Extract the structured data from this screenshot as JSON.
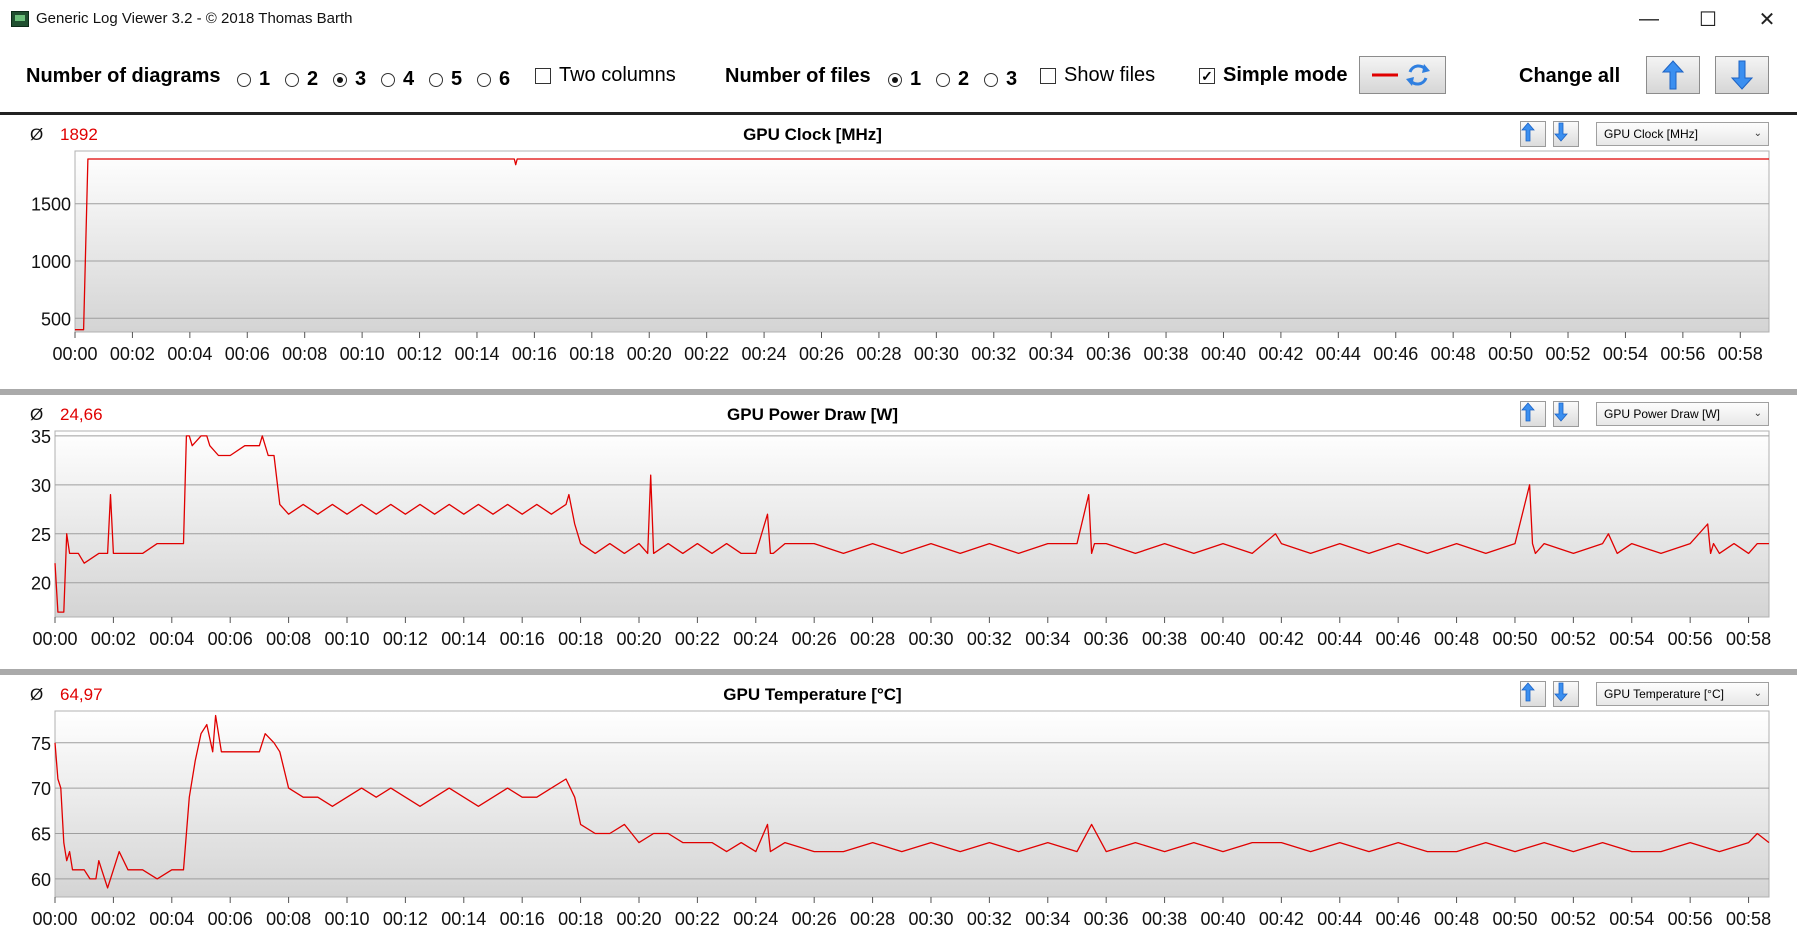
{
  "window": {
    "title": "Generic Log Viewer 3.2 - © 2018 Thomas Barth",
    "minimize": "—",
    "maximize": "☐",
    "close": "✕"
  },
  "toolbar": {
    "diagrams_label": "Number of diagrams",
    "diagram_options": [
      "1",
      "2",
      "3",
      "4",
      "5",
      "6"
    ],
    "diagram_selected": "3",
    "two_columns_label": "Two columns",
    "two_columns_checked": false,
    "files_label": "Number of files",
    "file_options": [
      "1",
      "2",
      "3"
    ],
    "file_selected": "1",
    "show_files_label": "Show files",
    "show_files_checked": false,
    "simple_mode_label": "Simple mode",
    "simple_mode_checked": true,
    "change_all_label": "Change all"
  },
  "colors": {
    "series": "#e00000",
    "grid": "#9e9e9e",
    "accent": "#2f7fe0"
  },
  "panels": [
    {
      "average_symbol": "Ø",
      "average_value": "1892",
      "title": "GPU Clock [MHz]",
      "selector": "GPU Clock [MHz]"
    },
    {
      "average_symbol": "Ø",
      "average_value": "24,66",
      "title": "GPU Power Draw [W]",
      "selector": "GPU Power Draw [W]"
    },
    {
      "average_symbol": "Ø",
      "average_value": "64,97",
      "title": "GPU Temperature [°C]",
      "selector": "GPU Temperature [°C]"
    }
  ],
  "chart_data": [
    {
      "type": "line",
      "title": "GPU Clock [MHz]",
      "x_ticks": [
        "00:00",
        "00:02",
        "00:04",
        "00:06",
        "00:08",
        "00:10",
        "00:12",
        "00:14",
        "00:16",
        "00:18",
        "00:20",
        "00:22",
        "00:24",
        "00:26",
        "00:28",
        "00:30",
        "00:32",
        "00:34",
        "00:36",
        "00:38",
        "00:40",
        "00:42",
        "00:44",
        "00:46",
        "00:48",
        "00:50",
        "00:52",
        "00:54",
        "00:56",
        "00:58"
      ],
      "y_ticks": [
        500,
        1000,
        1500
      ],
      "xlim": [
        0,
        59
      ],
      "ylim": [
        380,
        1960
      ],
      "series": [
        {
          "x": [
            0,
            0.3,
            0.45,
            15.3,
            15.35,
            15.4,
            59
          ],
          "y": [
            400,
            400,
            1890,
            1890,
            1840,
            1890,
            1890
          ]
        }
      ]
    },
    {
      "type": "line",
      "title": "GPU Power Draw [W]",
      "x_ticks": [
        "00:00",
        "00:02",
        "00:04",
        "00:06",
        "00:08",
        "00:10",
        "00:12",
        "00:14",
        "00:16",
        "00:18",
        "00:20",
        "00:22",
        "00:24",
        "00:26",
        "00:28",
        "00:30",
        "00:32",
        "00:34",
        "00:36",
        "00:38",
        "00:40",
        "00:42",
        "00:44",
        "00:46",
        "00:48",
        "00:50",
        "00:52",
        "00:54",
        "00:56",
        "00:58"
      ],
      "y_ticks": [
        20,
        25,
        30,
        35
      ],
      "xlim": [
        0,
        58.7
      ],
      "ylim": [
        16.5,
        35.5
      ],
      "series": [
        {
          "x": [
            0,
            0.1,
            0.2,
            0.3,
            0.4,
            0.5,
            0.6,
            0.8,
            1.0,
            1.5,
            1.8,
            1.9,
            2.0,
            2.2,
            3.0,
            3.5,
            4.4,
            4.5,
            4.6,
            4.7,
            5.0,
            5.2,
            5.3,
            5.6,
            6.0,
            6.5,
            7.0,
            7.1,
            7.3,
            7.5,
            7.7,
            8.0,
            8.5,
            9.0,
            9.5,
            10.0,
            10.5,
            11.0,
            11.5,
            12.0,
            12.5,
            13.0,
            13.5,
            14.0,
            14.5,
            15.0,
            15.5,
            16.0,
            16.5,
            17.0,
            17.5,
            17.6,
            17.8,
            18.0,
            18.5,
            19.0,
            19.5,
            20.0,
            20.3,
            20.4,
            20.5,
            21.0,
            21.5,
            22.0,
            22.5,
            23.0,
            23.5,
            24.0,
            24.4,
            24.5,
            24.6,
            25.0,
            26.0,
            27.0,
            28.0,
            29.0,
            30.0,
            31.0,
            32.0,
            33.0,
            34.0,
            35.0,
            35.4,
            35.5,
            35.6,
            36.0,
            37.0,
            38.0,
            39.0,
            40.0,
            41.0,
            41.8,
            42.0,
            43.0,
            44.0,
            45.0,
            46.0,
            47.0,
            48.0,
            49.0,
            50.0,
            50.5,
            50.6,
            50.7,
            51.0,
            52.0,
            53.0,
            53.2,
            53.5,
            54.0,
            55.0,
            56.0,
            56.6,
            56.7,
            56.8,
            57.0,
            57.5,
            58.0,
            58.3,
            58.7
          ],
          "y": [
            22,
            17,
            17,
            17,
            25,
            23,
            23,
            23,
            22,
            23,
            23,
            29,
            23,
            23,
            23,
            24,
            24,
            35,
            35,
            34,
            35,
            35,
            34,
            33,
            33,
            34,
            34,
            35,
            33,
            33,
            28,
            27,
            28,
            27,
            28,
            27,
            28,
            27,
            28,
            27,
            28,
            27,
            28,
            27,
            28,
            27,
            28,
            27,
            28,
            27,
            28,
            29,
            26,
            24,
            23,
            24,
            23,
            24,
            23,
            31,
            23,
            24,
            23,
            24,
            23,
            24,
            23,
            23,
            27,
            23,
            23,
            24,
            24,
            23,
            24,
            23,
            24,
            23,
            24,
            23,
            24,
            24,
            29,
            23,
            24,
            24,
            23,
            24,
            23,
            24,
            23,
            25,
            24,
            23,
            24,
            23,
            24,
            23,
            24,
            23,
            24,
            30,
            24,
            23,
            24,
            23,
            24,
            25,
            23,
            24,
            23,
            24,
            26,
            23,
            24,
            23,
            24,
            23,
            24,
            24
          ]
        }
      ]
    },
    {
      "type": "line",
      "title": "GPU Temperature [°C]",
      "x_ticks": [
        "00:00",
        "00:02",
        "00:04",
        "00:06",
        "00:08",
        "00:10",
        "00:12",
        "00:14",
        "00:16",
        "00:18",
        "00:20",
        "00:22",
        "00:24",
        "00:26",
        "00:28",
        "00:30",
        "00:32",
        "00:34",
        "00:36",
        "00:38",
        "00:40",
        "00:42",
        "00:44",
        "00:46",
        "00:48",
        "00:50",
        "00:52",
        "00:54",
        "00:56",
        "00:58"
      ],
      "y_ticks": [
        60,
        65,
        70,
        75
      ],
      "xlim": [
        0,
        58.7
      ],
      "ylim": [
        58,
        78.5
      ],
      "series": [
        {
          "x": [
            0,
            0.1,
            0.2,
            0.3,
            0.4,
            0.5,
            0.6,
            0.8,
            1.0,
            1.2,
            1.4,
            1.5,
            1.6,
            1.8,
            2.0,
            2.2,
            2.5,
            3.0,
            3.5,
            4.0,
            4.4,
            4.6,
            4.8,
            5.0,
            5.2,
            5.4,
            5.5,
            5.7,
            6.0,
            6.5,
            7.0,
            7.2,
            7.5,
            7.7,
            8.0,
            8.5,
            9.0,
            9.5,
            10.0,
            10.5,
            11.0,
            11.5,
            12.0,
            12.5,
            13.0,
            13.5,
            14.0,
            14.5,
            15.0,
            15.5,
            16.0,
            16.5,
            17.0,
            17.5,
            17.8,
            18.0,
            18.5,
            19.0,
            19.5,
            20.0,
            20.5,
            21.0,
            21.5,
            22.0,
            22.5,
            23.0,
            23.5,
            24.0,
            24.4,
            24.5,
            25.0,
            26.0,
            27.0,
            28.0,
            29.0,
            30.0,
            31.0,
            32.0,
            33.0,
            34.0,
            35.0,
            35.5,
            36.0,
            37.0,
            38.0,
            39.0,
            40.0,
            41.0,
            42.0,
            43.0,
            44.0,
            45.0,
            46.0,
            47.0,
            48.0,
            49.0,
            50.0,
            51.0,
            52.0,
            53.0,
            54.0,
            55.0,
            56.0,
            57.0,
            58.0,
            58.3,
            58.7
          ],
          "y": [
            75,
            71,
            70,
            64,
            62,
            63,
            61,
            61,
            61,
            60,
            60,
            62,
            61,
            59,
            61,
            63,
            61,
            61,
            60,
            61,
            61,
            69,
            73,
            76,
            77,
            74,
            78,
            74,
            74,
            74,
            74,
            76,
            75,
            74,
            70,
            69,
            69,
            68,
            69,
            70,
            69,
            70,
            69,
            68,
            69,
            70,
            69,
            68,
            69,
            70,
            69,
            69,
            70,
            71,
            69,
            66,
            65,
            65,
            66,
            64,
            65,
            65,
            64,
            64,
            64,
            63,
            64,
            63,
            66,
            63,
            64,
            63,
            63,
            64,
            63,
            64,
            63,
            64,
            63,
            64,
            63,
            66,
            63,
            64,
            63,
            64,
            63,
            64,
            64,
            63,
            64,
            63,
            64,
            63,
            63,
            64,
            63,
            64,
            63,
            64,
            63,
            63,
            64,
            63,
            64,
            65,
            64
          ]
        }
      ]
    }
  ]
}
